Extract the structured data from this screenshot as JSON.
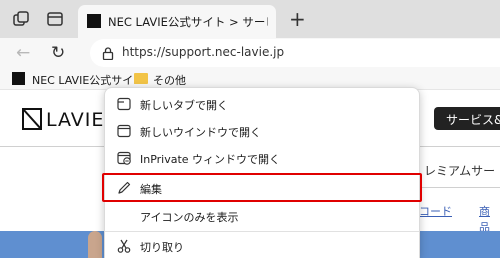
{
  "tab": {
    "title": "NEC LAVIE公式サイト > サービス&サ"
  },
  "address": {
    "url": "https://support.nec-lavie.jp"
  },
  "favorites": {
    "item1": "NEC LAVIE公式サイ...",
    "item2": "その他"
  },
  "page": {
    "logo": "LAVIE",
    "service_button": "サービス&サ",
    "premium_text": "レミアムサー",
    "link_code": "コード",
    "link_goods": "商品"
  },
  "context_menu": {
    "items": [
      {
        "label": "新しいタブで開く",
        "icon": "new-tab-icon"
      },
      {
        "label": "新しいウインドウで開く",
        "icon": "new-window-icon"
      },
      {
        "label": "InPrivate ウィンドウで開く",
        "icon": "inprivate-icon"
      },
      {
        "label": "編集",
        "icon": "pencil-icon"
      },
      {
        "label": "アイコンのみを表示",
        "icon": ""
      },
      {
        "label": "切り取り",
        "icon": "scissors-icon"
      }
    ]
  },
  "colors": {
    "highlight": "#e00000",
    "accent_link": "#3a5fb5",
    "banner": "#5f8fd0"
  }
}
